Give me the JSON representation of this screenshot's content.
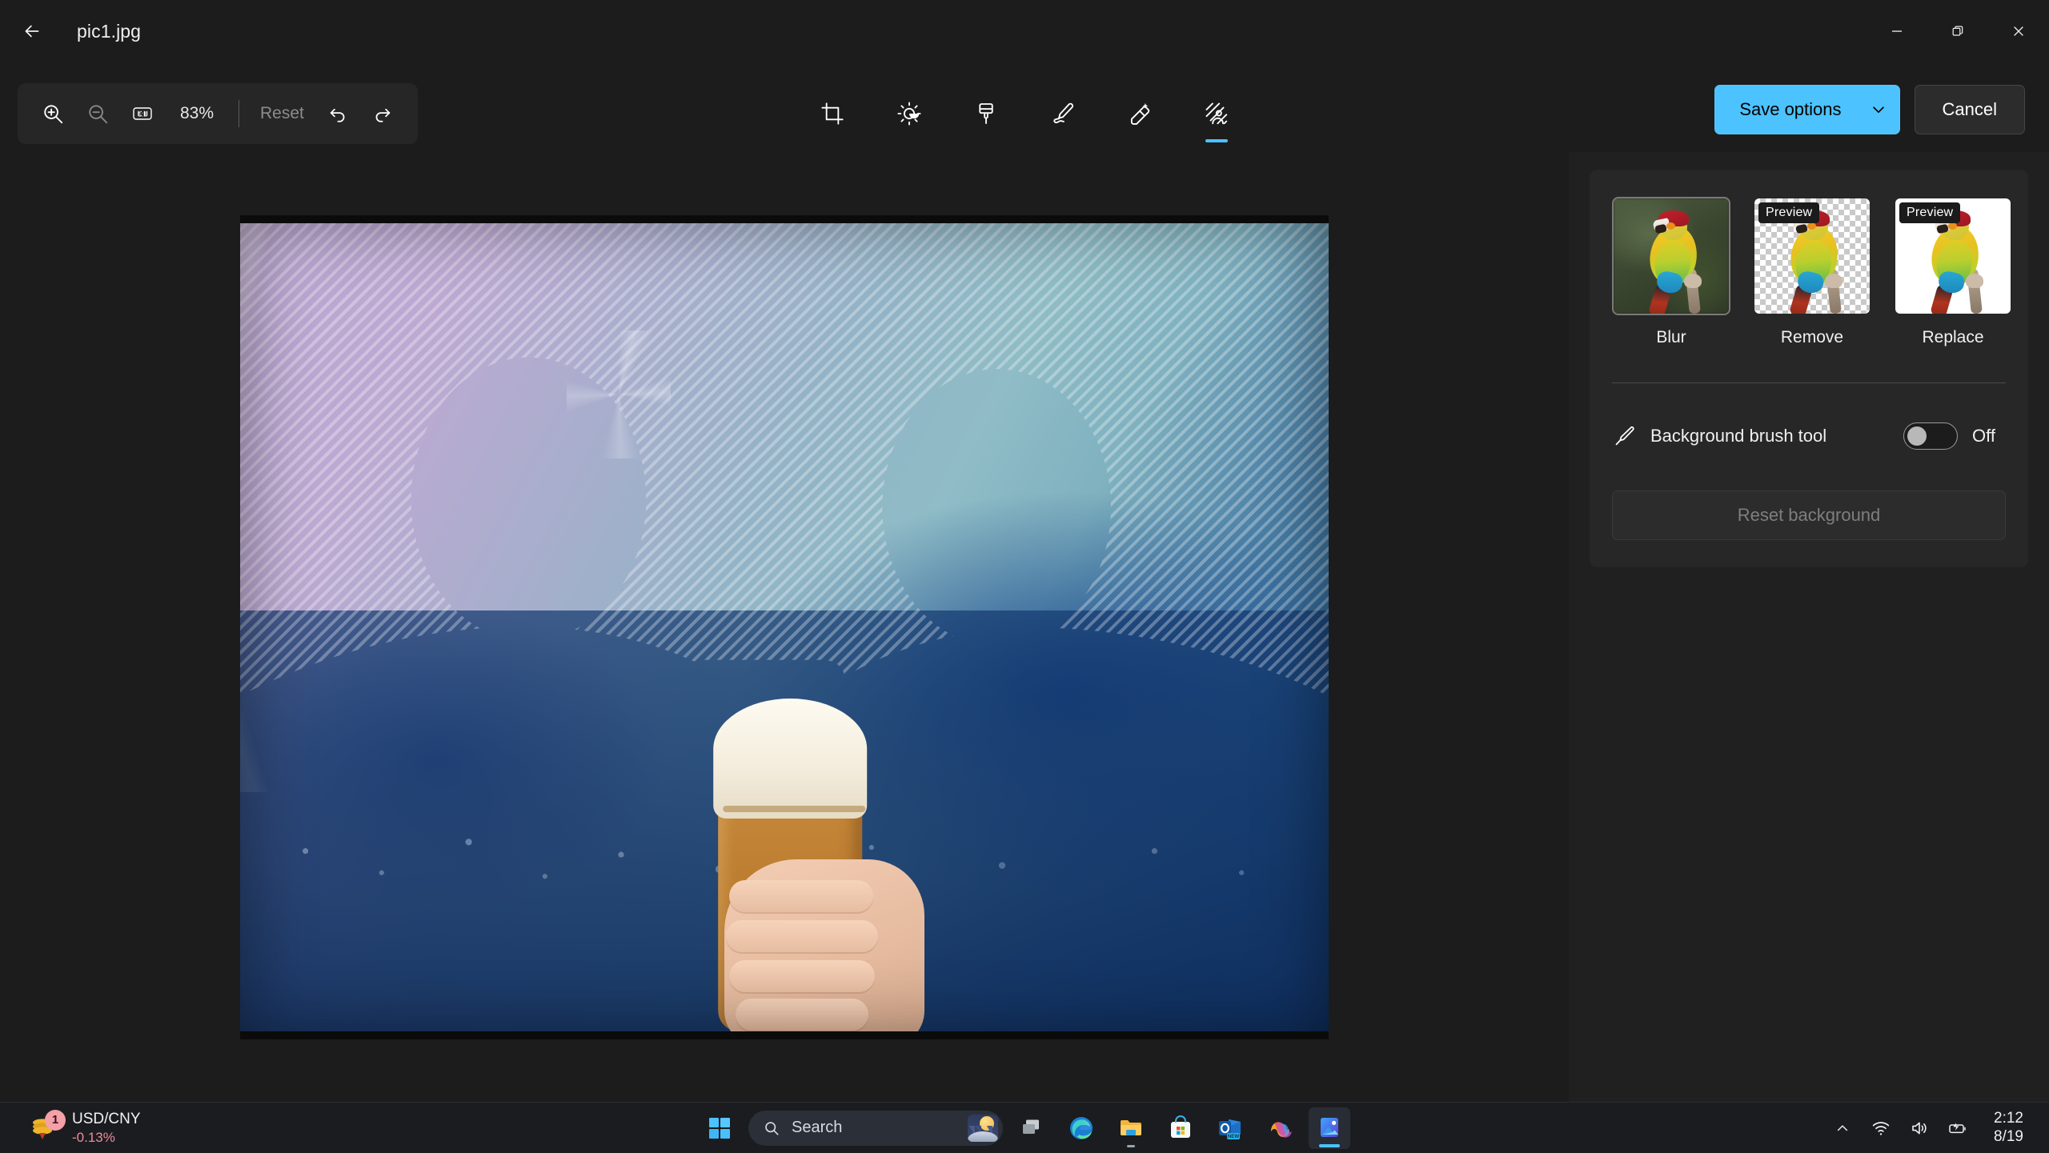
{
  "window": {
    "title": "pic1.jpg",
    "back_icon": "back-arrow-icon",
    "minimize_icon": "minimize-icon",
    "restore_icon": "restore-icon",
    "close_icon": "close-icon"
  },
  "zoom_toolbar": {
    "zoom_in_icon": "zoom-in-icon",
    "zoom_out_icon": "zoom-out-icon",
    "actual_size_icon": "one-to-one-icon",
    "actual_size_label": "1:1",
    "zoom_level": "83%",
    "reset_label": "Reset",
    "undo_icon": "undo-icon",
    "redo_icon": "redo-icon"
  },
  "edit_tools": [
    {
      "name": "crop",
      "icon": "crop-icon",
      "active": false
    },
    {
      "name": "adjustment",
      "icon": "brightness-icon",
      "active": false
    },
    {
      "name": "filters",
      "icon": "paintbrush-icon",
      "active": false
    },
    {
      "name": "markup",
      "icon": "pen-icon",
      "active": false
    },
    {
      "name": "erase",
      "icon": "magic-eraser-icon",
      "active": false
    },
    {
      "name": "background",
      "icon": "background-icon",
      "active": true
    }
  ],
  "actions": {
    "save_label": "Save options",
    "save_caret_icon": "chevron-down-icon",
    "cancel_label": "Cancel",
    "accent_color": "#4cc2ff"
  },
  "panel": {
    "options": [
      {
        "label": "Blur",
        "badge": "",
        "style": "blur",
        "selected": true
      },
      {
        "label": "Remove",
        "badge": "Preview",
        "style": "checker",
        "selected": false
      },
      {
        "label": "Replace",
        "badge": "Preview",
        "style": "white",
        "selected": false
      }
    ],
    "brush": {
      "icon": "paintbrush-icon",
      "label": "Background brush tool",
      "state": "Off"
    },
    "reset_background_label": "Reset background"
  },
  "taskbar": {
    "widget": {
      "icon": "coins-icon",
      "badge": "1",
      "title": "USD/CNY",
      "delta": "-0.13%",
      "delta_color": "#f08a9a"
    },
    "start_icon": "windows-start-icon",
    "search": {
      "icon": "search-icon",
      "placeholder": "Search",
      "thumb_icon": "moon-landscape-icon"
    },
    "apps": [
      {
        "name": "task-view",
        "icon": "task-view-icon",
        "active": false
      },
      {
        "name": "microsoft-edge",
        "icon": "edge-icon",
        "active": false
      },
      {
        "name": "file-explorer",
        "icon": "file-explorer-icon",
        "active": false
      },
      {
        "name": "microsoft-store",
        "icon": "store-icon",
        "active": false
      },
      {
        "name": "outlook",
        "icon": "outlook-icon",
        "active": false,
        "badge": "NEW"
      },
      {
        "name": "copilot",
        "icon": "copilot-icon",
        "active": false
      },
      {
        "name": "photos",
        "icon": "photos-icon",
        "active": true
      }
    ],
    "tray": {
      "chevron_icon": "chevron-up-icon",
      "wifi_icon": "wifi-icon",
      "volume_icon": "volume-icon",
      "battery_icon": "battery-charging-icon",
      "time": "2:12",
      "date": "8/19"
    }
  }
}
